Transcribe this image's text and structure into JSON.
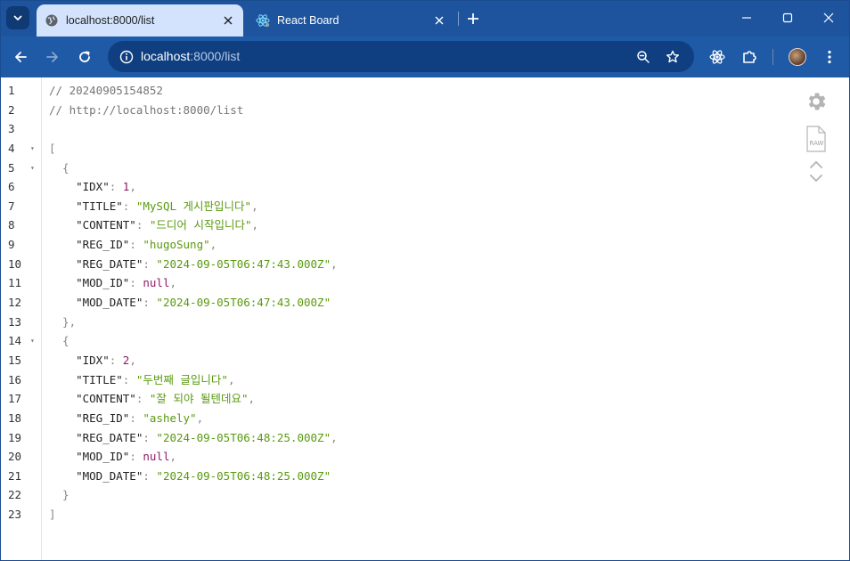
{
  "tabs": [
    {
      "title": "localhost:8000/list",
      "favicon": "globe-icon",
      "active": true
    },
    {
      "title": "React Board",
      "favicon": "react-icon",
      "active": false
    }
  ],
  "address_bar": {
    "host": "localhost",
    "rest": ":8000/list"
  },
  "colors": {
    "frame": "#1e549e",
    "toolbar": "#d3e3fd",
    "omnibox": "#1f5aa6",
    "json_string": "#5a9a10",
    "json_number": "#8b1c68"
  },
  "code_lines": [
    {
      "num": "1",
      "fold": false,
      "tokens": [
        {
          "t": "// 20240905154852",
          "c": "comment"
        }
      ]
    },
    {
      "num": "2",
      "fold": false,
      "tokens": [
        {
          "t": "// http://localhost:8000/list",
          "c": "comment"
        }
      ]
    },
    {
      "num": "3",
      "fold": false,
      "tokens": []
    },
    {
      "num": "4",
      "fold": true,
      "tokens": [
        {
          "t": "[",
          "c": "punc"
        }
      ]
    },
    {
      "num": "5",
      "fold": true,
      "tokens": [
        {
          "t": "  {",
          "c": "punc"
        }
      ]
    },
    {
      "num": "6",
      "fold": false,
      "tokens": [
        {
          "t": "    \"IDX\"",
          "c": "key"
        },
        {
          "t": ": ",
          "c": "punc"
        },
        {
          "t": "1",
          "c": "num"
        },
        {
          "t": ",",
          "c": "punc"
        }
      ]
    },
    {
      "num": "7",
      "fold": false,
      "tokens": [
        {
          "t": "    \"TITLE\"",
          "c": "key"
        },
        {
          "t": ": ",
          "c": "punc"
        },
        {
          "t": "\"MySQL 게시판입니다\"",
          "c": "str"
        },
        {
          "t": ",",
          "c": "punc"
        }
      ]
    },
    {
      "num": "8",
      "fold": false,
      "tokens": [
        {
          "t": "    \"CONTENT\"",
          "c": "key"
        },
        {
          "t": ": ",
          "c": "punc"
        },
        {
          "t": "\"드디어 시작입니다\"",
          "c": "str"
        },
        {
          "t": ",",
          "c": "punc"
        }
      ]
    },
    {
      "num": "9",
      "fold": false,
      "tokens": [
        {
          "t": "    \"REG_ID\"",
          "c": "key"
        },
        {
          "t": ": ",
          "c": "punc"
        },
        {
          "t": "\"hugoSung\"",
          "c": "str"
        },
        {
          "t": ",",
          "c": "punc"
        }
      ]
    },
    {
      "num": "10",
      "fold": false,
      "tokens": [
        {
          "t": "    \"REG_DATE\"",
          "c": "key"
        },
        {
          "t": ": ",
          "c": "punc"
        },
        {
          "t": "\"2024-09-05T06:47:43.000Z\"",
          "c": "str"
        },
        {
          "t": ",",
          "c": "punc"
        }
      ]
    },
    {
      "num": "11",
      "fold": false,
      "tokens": [
        {
          "t": "    \"MOD_ID\"",
          "c": "key"
        },
        {
          "t": ": ",
          "c": "punc"
        },
        {
          "t": "null",
          "c": "null"
        },
        {
          "t": ",",
          "c": "punc"
        }
      ]
    },
    {
      "num": "12",
      "fold": false,
      "tokens": [
        {
          "t": "    \"MOD_DATE\"",
          "c": "key"
        },
        {
          "t": ": ",
          "c": "punc"
        },
        {
          "t": "\"2024-09-05T06:47:43.000Z\"",
          "c": "str"
        }
      ]
    },
    {
      "num": "13",
      "fold": false,
      "tokens": [
        {
          "t": "  },",
          "c": "punc"
        }
      ]
    },
    {
      "num": "14",
      "fold": true,
      "tokens": [
        {
          "t": "  {",
          "c": "punc"
        }
      ]
    },
    {
      "num": "15",
      "fold": false,
      "tokens": [
        {
          "t": "    \"IDX\"",
          "c": "key"
        },
        {
          "t": ": ",
          "c": "punc"
        },
        {
          "t": "2",
          "c": "num"
        },
        {
          "t": ",",
          "c": "punc"
        }
      ]
    },
    {
      "num": "16",
      "fold": false,
      "tokens": [
        {
          "t": "    \"TITLE\"",
          "c": "key"
        },
        {
          "t": ": ",
          "c": "punc"
        },
        {
          "t": "\"두번째 글입니다\"",
          "c": "str"
        },
        {
          "t": ",",
          "c": "punc"
        }
      ]
    },
    {
      "num": "17",
      "fold": false,
      "tokens": [
        {
          "t": "    \"CONTENT\"",
          "c": "key"
        },
        {
          "t": ": ",
          "c": "punc"
        },
        {
          "t": "\"잘 되야 될텐데요\"",
          "c": "str"
        },
        {
          "t": ",",
          "c": "punc"
        }
      ]
    },
    {
      "num": "18",
      "fold": false,
      "tokens": [
        {
          "t": "    \"REG_ID\"",
          "c": "key"
        },
        {
          "t": ": ",
          "c": "punc"
        },
        {
          "t": "\"ashely\"",
          "c": "str"
        },
        {
          "t": ",",
          "c": "punc"
        }
      ]
    },
    {
      "num": "19",
      "fold": false,
      "tokens": [
        {
          "t": "    \"REG_DATE\"",
          "c": "key"
        },
        {
          "t": ": ",
          "c": "punc"
        },
        {
          "t": "\"2024-09-05T06:48:25.000Z\"",
          "c": "str"
        },
        {
          "t": ",",
          "c": "punc"
        }
      ]
    },
    {
      "num": "20",
      "fold": false,
      "tokens": [
        {
          "t": "    \"MOD_ID\"",
          "c": "key"
        },
        {
          "t": ": ",
          "c": "punc"
        },
        {
          "t": "null",
          "c": "null"
        },
        {
          "t": ",",
          "c": "punc"
        }
      ]
    },
    {
      "num": "21",
      "fold": false,
      "tokens": [
        {
          "t": "    \"MOD_DATE\"",
          "c": "key"
        },
        {
          "t": ": ",
          "c": "punc"
        },
        {
          "t": "\"2024-09-05T06:48:25.000Z\"",
          "c": "str"
        }
      ]
    },
    {
      "num": "22",
      "fold": false,
      "tokens": [
        {
          "t": "  }",
          "c": "punc"
        }
      ]
    },
    {
      "num": "23",
      "fold": false,
      "tokens": [
        {
          "t": "]",
          "c": "punc"
        }
      ]
    }
  ],
  "side_tools": {
    "raw_label": "RAW"
  }
}
